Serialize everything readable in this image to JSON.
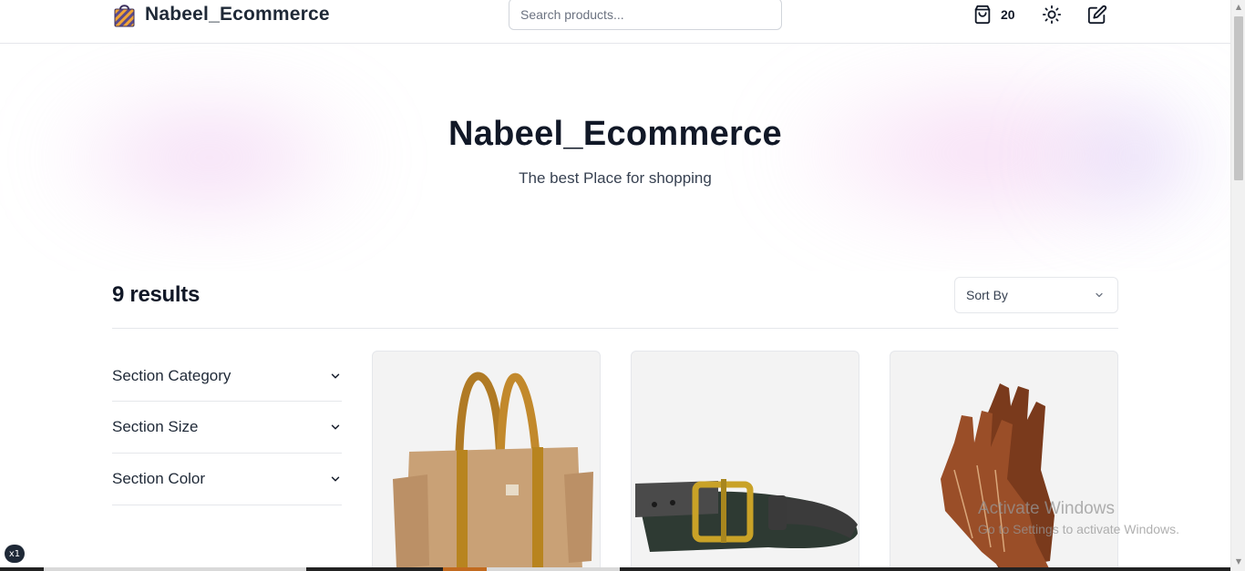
{
  "header": {
    "brand_name": "Nabeel_Ecommerce",
    "search_placeholder": "Search products...",
    "cart_count": "20"
  },
  "hero": {
    "title": "Nabeel_Ecommerce",
    "subtitle": "The best Place for shopping"
  },
  "results": {
    "count_text": "9 results",
    "sort_label": "Sort By"
  },
  "filters": [
    {
      "label": "Section Category"
    },
    {
      "label": "Section Size"
    },
    {
      "label": "Section Color"
    }
  ],
  "products": [
    {
      "icon": "tote-bag-image"
    },
    {
      "icon": "leather-belt-image"
    },
    {
      "icon": "leather-gloves-image"
    }
  ],
  "watermark": {
    "title": "Activate Windows",
    "subtitle": "Go to Settings to activate Windows."
  },
  "badge": "x1",
  "colors": {
    "text_primary": "#111827",
    "border": "#e5e7eb",
    "hero_blob_pink": "#e9b6eb",
    "hero_blob_lavender": "#cebef5"
  }
}
